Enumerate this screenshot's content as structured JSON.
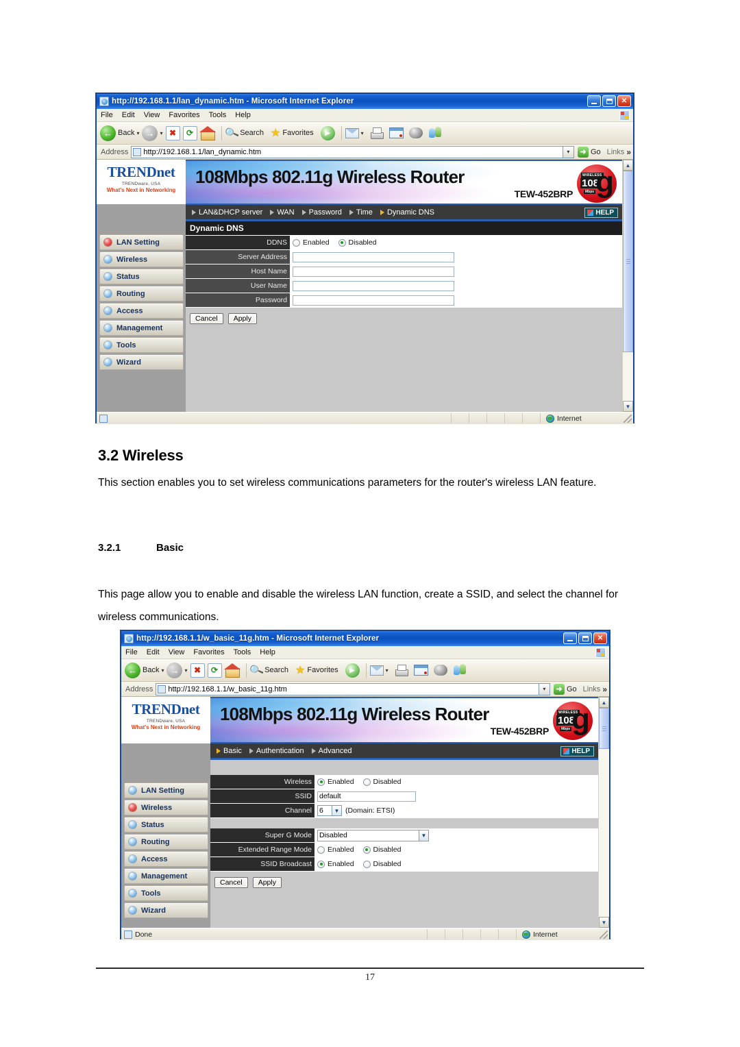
{
  "document": {
    "section_heading": "3.2 Wireless",
    "intro_paragraph": "This section enables you to set wireless communications parameters for the router's wireless LAN feature.",
    "subsection_number": "3.2.1",
    "subsection_title": "Basic",
    "body_paragraph": "This page allow you to enable and disable the wireless LAN function, create a SSID, and select the channel for wireless communications.",
    "page_number": "17"
  },
  "browser_chrome": {
    "menu_items": [
      "File",
      "Edit",
      "View",
      "Favorites",
      "Tools",
      "Help"
    ],
    "toolbar": {
      "back_label": "Back",
      "forward_label": "",
      "stop_label": "",
      "refresh_label": "",
      "home_label": "",
      "search_label": "Search",
      "favorites_label": "Favorites",
      "media_label": "",
      "history_label": "",
      "mail_label": "",
      "print_label": "",
      "edit_label": "",
      "discuss_label": "",
      "messenger_label": ""
    },
    "address": {
      "label": "Address",
      "go_label": "Go",
      "links_label": "Links"
    },
    "window_buttons": {
      "minimize": "_",
      "maximize": "□",
      "close": "✕"
    }
  },
  "router_ui": {
    "brand": {
      "name_part1": "TRENDnet",
      "tagline1": "TRENDware, USA",
      "tagline2": "What's Next in Networking"
    },
    "banner": {
      "title": "108Mbps 802.11g Wireless Router",
      "model": "TEW-452BRP",
      "badge_wireless": "WIRELESS",
      "badge_speed": "108",
      "badge_units": "Mbps",
      "badge_standard": "g"
    },
    "help_label": "HELP",
    "sidebar_items": [
      {
        "label": "LAN Setting",
        "active": true
      },
      {
        "label": "Wireless",
        "active": false
      },
      {
        "label": "Status",
        "active": false
      },
      {
        "label": "Routing",
        "active": false
      },
      {
        "label": "Access",
        "active": false
      },
      {
        "label": "Management",
        "active": false
      },
      {
        "label": "Tools",
        "active": false
      },
      {
        "label": "Wizard",
        "active": false
      }
    ],
    "sidebar_items_win2": [
      {
        "label": "LAN Setting",
        "active": false
      },
      {
        "label": "Wireless",
        "active": true
      },
      {
        "label": "Status",
        "active": false
      },
      {
        "label": "Routing",
        "active": false
      },
      {
        "label": "Access",
        "active": false
      },
      {
        "label": "Management",
        "active": false
      },
      {
        "label": "Tools",
        "active": false
      },
      {
        "label": "Wizard",
        "active": false
      }
    ],
    "buttons": {
      "cancel": "Cancel",
      "apply": "Apply"
    },
    "radio_labels": {
      "enabled": "Enabled",
      "disabled": "Disabled"
    }
  },
  "window1": {
    "title": "http://192.168.1.1/lan_dynamic.htm - Microsoft Internet Explorer",
    "address_value": "http://192.168.1.1/lan_dynamic.htm",
    "tabs": [
      {
        "label": "LAN&DHCP server",
        "active": false
      },
      {
        "label": "WAN",
        "active": false
      },
      {
        "label": "Password",
        "active": false
      },
      {
        "label": "Time",
        "active": false
      },
      {
        "label": "Dynamic DNS",
        "active": true
      }
    ],
    "panel_title": "Dynamic DNS",
    "fields": {
      "ddns_label": "DDNS",
      "ddns_enabled_selected": false,
      "ddns_disabled_selected": true,
      "server_address_label": "Server Address",
      "server_address_value": "",
      "host_name_label": "Host Name",
      "host_name_value": "",
      "user_name_label": "User Name",
      "user_name_value": "",
      "password_label": "Password",
      "password_value": ""
    },
    "status": {
      "text": "",
      "zone": "Internet"
    }
  },
  "window2": {
    "title": "http://192.168.1.1/w_basic_11g.htm - Microsoft Internet Explorer",
    "address_value": "http://192.168.1.1/w_basic_11g.htm",
    "tabs": [
      {
        "label": "Basic",
        "active": true
      },
      {
        "label": "Authentication",
        "active": false
      },
      {
        "label": "Advanced",
        "active": false
      }
    ],
    "fields": {
      "wireless_label": "Wireless",
      "wireless_enabled_selected": true,
      "wireless_disabled_selected": false,
      "ssid_label": "SSID",
      "ssid_value": "default",
      "channel_label": "Channel",
      "channel_value": "6",
      "channel_note": "(Domain: ETSI)",
      "super_g_label": "Super G Mode",
      "super_g_value": "Disabled",
      "extended_range_label": "Extended Range Mode",
      "extended_range_enabled_selected": false,
      "extended_range_disabled_selected": true,
      "ssid_broadcast_label": "SSID Broadcast",
      "ssid_broadcast_enabled_selected": true,
      "ssid_broadcast_disabled_selected": false
    },
    "status": {
      "text": "Done",
      "zone": "Internet"
    }
  }
}
